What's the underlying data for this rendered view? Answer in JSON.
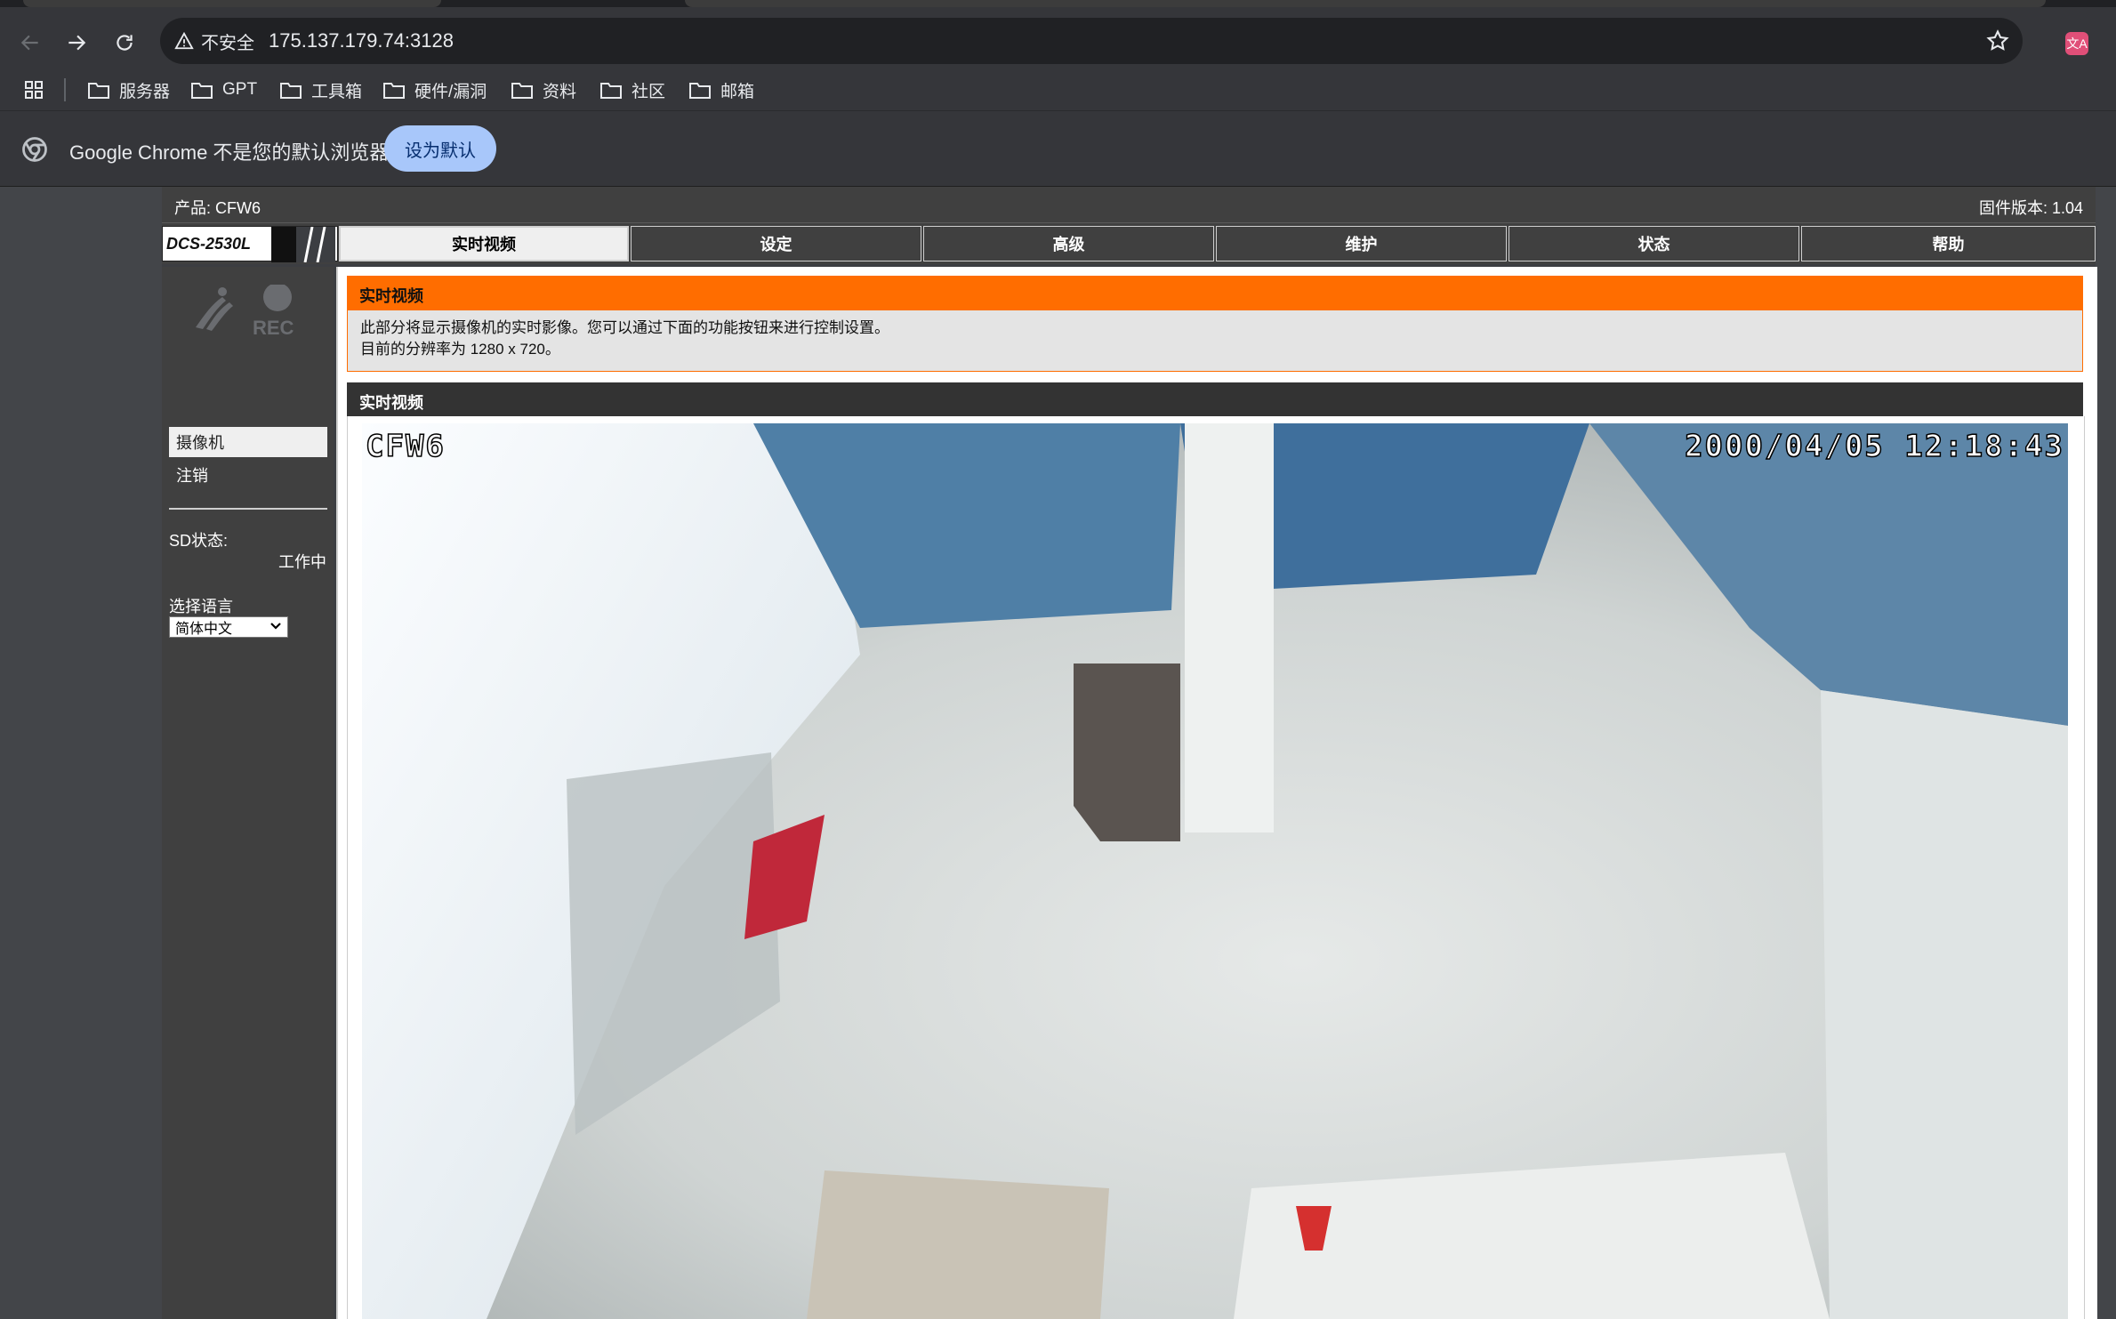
{
  "browser": {
    "security_label": "不安全",
    "url": "175.137.179.74:3128",
    "extension_label": "文A",
    "bookmarks": [
      "服务器",
      "GPT",
      "工具箱",
      "硬件/漏洞",
      "资料",
      "社区",
      "邮箱"
    ],
    "infobar_text": "Google Chrome 不是您的默认浏览器",
    "infobar_button": "设为默认"
  },
  "camera_page": {
    "product": "产品: CFW6",
    "firmware": "固件版本: 1.04",
    "model": "DCS-2530L",
    "tabs": [
      "实时视频",
      "设定",
      "高级",
      "维护",
      "状态",
      "帮助"
    ],
    "active_tab": "实时视频",
    "sidebar": {
      "logo_text": "REC",
      "menu": [
        "摄像机",
        "注销"
      ],
      "sd_label": "SD状态:",
      "sd_value": "工作中",
      "lang_label": "选择语言",
      "lang_selected": "简体中文"
    },
    "section_title": "实时视频",
    "description": [
      "此部分将显示摄像机的实时影像。您可以通过下面的功能按钮来进行控制设置。",
      "目前的分辨率为 1280 x 720。"
    ],
    "video_title": "实时视频",
    "osd_name": "CFW6",
    "osd_time": "2000/04/05 12:18:43"
  },
  "colors": {
    "accent_orange": "#ff6d00",
    "chrome_button": "#a8c7fa"
  }
}
